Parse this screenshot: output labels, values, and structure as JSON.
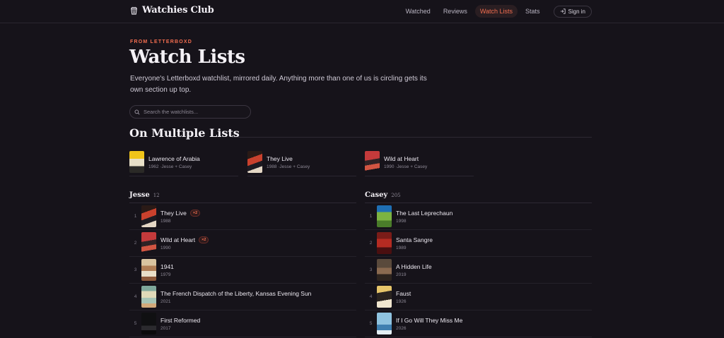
{
  "header": {
    "brand": "Watchies Club",
    "nav": [
      {
        "label": "Watched",
        "active": false
      },
      {
        "label": "Reviews",
        "active": false
      },
      {
        "label": "Watch Lists",
        "active": true
      },
      {
        "label": "Stats",
        "active": false
      }
    ],
    "signin_label": "Sign in"
  },
  "hero": {
    "eyebrow": "FROM LETTERBOXD",
    "title": "Watch Lists",
    "lede": "Everyone's Letterboxd watchlist, mirrored daily. Anything more than one of us is circling gets its own section up top."
  },
  "search": {
    "placeholder": "Search the watchlists..."
  },
  "multiple": {
    "title": "On Multiple Lists",
    "items": [
      {
        "title": "Lawrence of Arabia",
        "meta": "1962 ·Jesse + Casey"
      },
      {
        "title": "They Live",
        "meta": "1988 ·Jesse + Casey"
      },
      {
        "title": "Wild at Heart",
        "meta": "1990 ·Jesse + Casey"
      }
    ]
  },
  "lists": [
    {
      "name": "Jesse",
      "count": "12",
      "items": [
        {
          "rank": "1",
          "title": "They Live",
          "year": "1988",
          "badge": "×2"
        },
        {
          "rank": "2",
          "title": "Wild at Heart",
          "year": "1990",
          "badge": "×2"
        },
        {
          "rank": "3",
          "title": "1941",
          "year": "1979",
          "badge": ""
        },
        {
          "rank": "4",
          "title": "The French Dispatch of the Liberty, Kansas Evening Sun",
          "year": "2021",
          "badge": ""
        },
        {
          "rank": "5",
          "title": "First Reformed",
          "year": "2017",
          "badge": ""
        }
      ]
    },
    {
      "name": "Casey",
      "count": "205",
      "items": [
        {
          "rank": "1",
          "title": "The Last Leprechaun",
          "year": "1998",
          "badge": ""
        },
        {
          "rank": "2",
          "title": "Santa Sangre",
          "year": "1989",
          "badge": ""
        },
        {
          "rank": "3",
          "title": "A Hidden Life",
          "year": "2019",
          "badge": ""
        },
        {
          "rank": "4",
          "title": "Faust",
          "year": "1926",
          "badge": ""
        },
        {
          "rank": "5",
          "title": "If I Go Will They Miss Me",
          "year": "2026",
          "badge": ""
        }
      ]
    }
  ],
  "colors": {
    "accent": "#f26d4f",
    "background": "#16131a"
  }
}
